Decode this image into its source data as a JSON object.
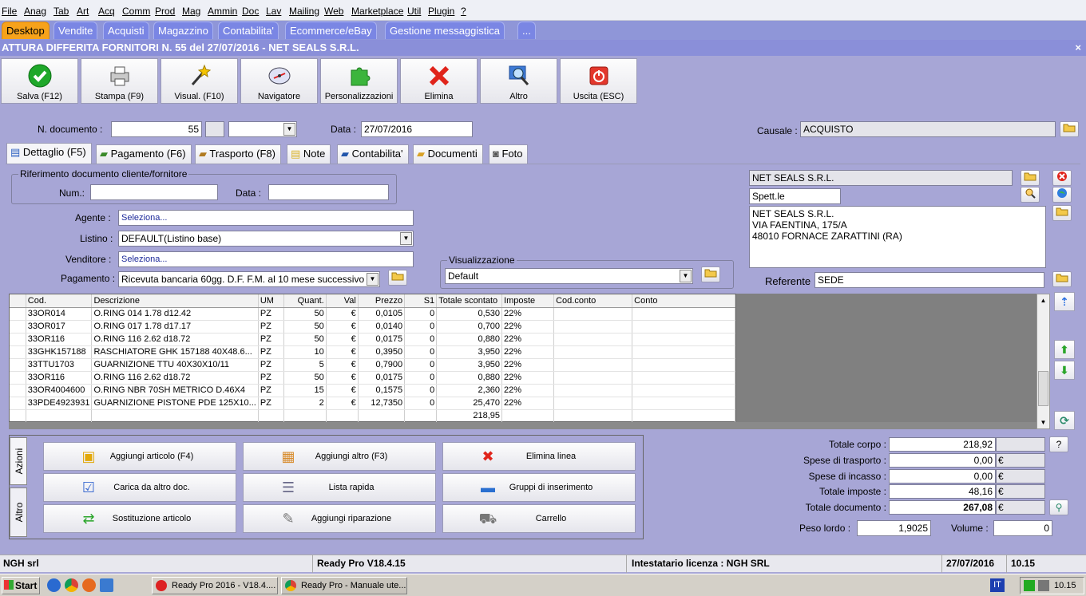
{
  "menu": [
    "File",
    "Anag",
    "Tab",
    "Art",
    "Acq",
    "Comm",
    "Prod",
    "Mag",
    "Ammin",
    "Doc",
    "Lav",
    "Mailing",
    "Web",
    "Marketplace",
    "Util",
    "Plugin",
    "?"
  ],
  "main_tabs": [
    "Desktop",
    "Vendite",
    "Acquisti",
    "Magazzino",
    "Contabilita'",
    "Ecommerce/eBay",
    "Gestione messaggistica",
    "..."
  ],
  "window_title": "ATTURA DIFFERITA FORNITORI N. 55 del 27/07/2016 - NET SEALS S.R.L.",
  "close_glyph": "×",
  "toolbar": [
    {
      "label": "Salva (F12)",
      "icon": "check-icon"
    },
    {
      "label": "Stampa (F9)",
      "icon": "printer-icon"
    },
    {
      "label": "Visual. (F10)",
      "icon": "magic-wand-icon"
    },
    {
      "label": "Navigatore",
      "icon": "compass-icon"
    },
    {
      "label": "Personalizzazioni",
      "icon": "puzzle-icon"
    },
    {
      "label": "Elimina",
      "icon": "red-x-icon"
    },
    {
      "label": "Altro",
      "icon": "magnifier-icon"
    },
    {
      "label": "Uscita (ESC)",
      "icon": "power-icon"
    }
  ],
  "header": {
    "n_doc_label": "N. documento :",
    "n_doc_value": "55",
    "data_label": "Data :",
    "data_value": "27/07/2016",
    "causale_label": "Causale :",
    "causale_value": "ACQUISTO"
  },
  "sub_tabs": [
    "Dettaglio (F5)",
    "Pagamento (F6)",
    "Trasporto (F8)",
    "Note",
    "Contabilita'",
    "Documenti",
    "Foto"
  ],
  "riferimento": {
    "title": "Riferimento documento cliente/fornitore",
    "num_label": "Num.:",
    "num_value": "",
    "data_label": "Data :",
    "data_value": ""
  },
  "agente": {
    "label": "Agente :",
    "value": "Seleziona..."
  },
  "listino": {
    "label": "Listino :",
    "value": "DEFAULT(Listino base)"
  },
  "venditore": {
    "label": "Venditore :",
    "value": "Seleziona..."
  },
  "pagamento": {
    "label": "Pagamento :",
    "value": "Ricevuta bancaria 60gg. D.F. F.M. al 10 mese successivo"
  },
  "visualizzazione": {
    "title": "Visualizzazione",
    "value": "Default"
  },
  "fornitore": {
    "name": "NET SEALS S.R.L.",
    "title": "Spett.le",
    "address": [
      "NET SEALS S.R.L.",
      "VIA FAENTINA, 175/A",
      "48010 FORNACE ZARATTINI (RA)"
    ],
    "referente_label": "Referente",
    "referente_value": "SEDE"
  },
  "grid": {
    "columns": [
      "",
      "Cod.",
      "Descrizione",
      "UM",
      "Quant.",
      "Val",
      "Prezzo",
      "S1",
      "Totale scontato",
      "Imposte",
      "Cod.conto",
      "Conto"
    ],
    "rows": [
      [
        "",
        "33OR014",
        "O.RING 014 1.78 d12.42",
        "PZ",
        "50",
        "€",
        "0,0105",
        "0",
        "0,530",
        "22%",
        "",
        ""
      ],
      [
        "",
        "33OR017",
        "O.RING 017 1.78 d17.17",
        "PZ",
        "50",
        "€",
        "0,0140",
        "0",
        "0,700",
        "22%",
        "",
        ""
      ],
      [
        "",
        "33OR116",
        "O.RING 116 2.62 d18.72",
        "PZ",
        "50",
        "€",
        "0,0175",
        "0",
        "0,880",
        "22%",
        "",
        ""
      ],
      [
        "",
        "33GHK157188",
        "RASCHIATORE GHK 157188 40X48.6...",
        "PZ",
        "10",
        "€",
        "0,3950",
        "0",
        "3,950",
        "22%",
        "",
        ""
      ],
      [
        "",
        "33TTU1703",
        "GUARNIZIONE TTU 40X30X10/11",
        "PZ",
        "5",
        "€",
        "0,7900",
        "0",
        "3,950",
        "22%",
        "",
        ""
      ],
      [
        "",
        "33OR116",
        "O.RING 116 2.62 d18.72",
        "PZ",
        "50",
        "€",
        "0,0175",
        "0",
        "0,880",
        "22%",
        "",
        ""
      ],
      [
        "",
        "33OR4004600",
        "O.RING NBR 70SH METRICO D.46X4",
        "PZ",
        "15",
        "€",
        "0,1575",
        "0",
        "2,360",
        "22%",
        "",
        ""
      ],
      [
        "",
        "33PDE4923931",
        "GUARNIZIONE PISTONE PDE 125X10...",
        "PZ",
        "2",
        "€",
        "12,7350",
        "0",
        "25,470",
        "22%",
        "",
        ""
      ],
      [
        "",
        "",
        "",
        "",
        "",
        "",
        "",
        "",
        "218,95",
        "",
        "",
        ""
      ]
    ]
  },
  "action_tabs": [
    "Azioni",
    "Altro"
  ],
  "actions": [
    {
      "label": "Aggiungi articolo (F4)",
      "icon": "box-add-icon"
    },
    {
      "label": "Aggiungi altro (F3)",
      "icon": "grid-add-icon"
    },
    {
      "label": "Elimina linea",
      "icon": "red-x-icon"
    },
    {
      "label": "Carica da altro doc.",
      "icon": "doc-check-icon"
    },
    {
      "label": "Lista rapida",
      "icon": "list-icon"
    },
    {
      "label": "Gruppi di inserimento",
      "icon": "group-add-icon"
    },
    {
      "label": "Sostituzione articolo",
      "icon": "swap-icon"
    },
    {
      "label": "Aggiungi riparazione",
      "icon": "wrench-icon"
    },
    {
      "label": "Carrello",
      "icon": "cart-icon"
    }
  ],
  "totals": {
    "corpo": {
      "label": "Totale corpo :",
      "value": "218,92"
    },
    "trasporto": {
      "label": "Spese di trasporto :",
      "value": "0,00"
    },
    "incasso": {
      "label": "Spese di incasso :",
      "value": "0,00"
    },
    "imposte": {
      "label": "Totale imposte :",
      "value": "48,16"
    },
    "documento": {
      "label": "Totale documento :",
      "value": "267,08"
    },
    "currency": "€",
    "peso_label": "Peso lordo :",
    "peso_value": "1,9025",
    "volume_label": "Volume :",
    "volume_value": "0",
    "help": "?"
  },
  "status": {
    "company": "NGH srl",
    "version": "Ready Pro V18.4.15",
    "license": "Intestatario licenza : NGH SRL",
    "date": "27/07/2016",
    "time": "10.15"
  },
  "taskbar": {
    "start": "Start",
    "tasks": [
      "Ready Pro 2016 - V18.4....",
      "Ready Pro - Manuale ute..."
    ],
    "lang": "IT",
    "clock": "10.15"
  },
  "colors": {
    "accent_tab": "#f7a21b",
    "background": "#a7a6d6",
    "link": "#1d2a9a"
  }
}
